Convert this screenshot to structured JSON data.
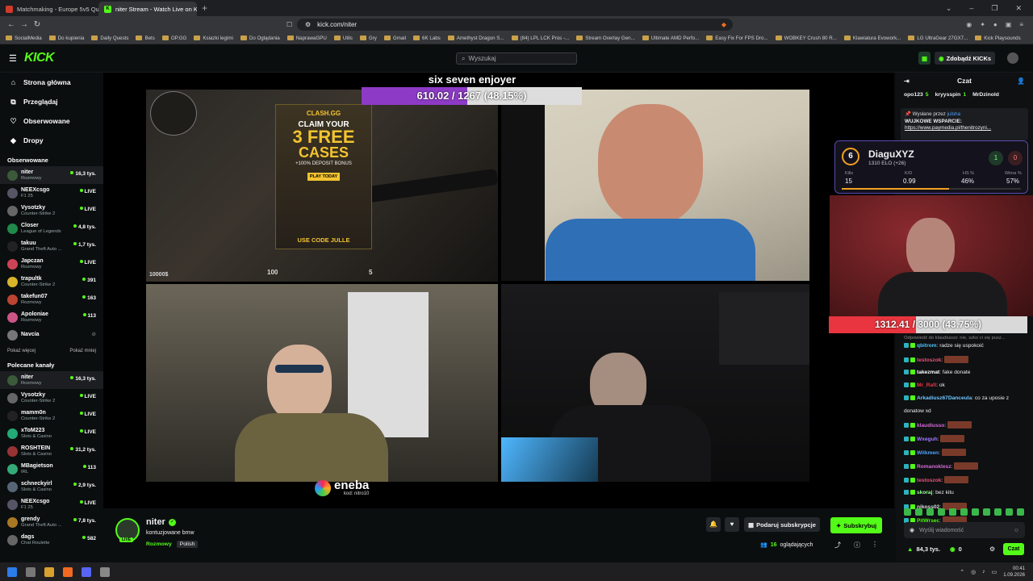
{
  "browser": {
    "tabs": [
      {
        "title": "Matchmaking - Europe 5v5 Queue -",
        "color": "#d23a2a",
        "active": false
      },
      {
        "title": "niter Stream - Watch Live on Kick",
        "color": "#53fc18",
        "active": true
      }
    ],
    "new_tab": "+",
    "url": "kick.com/niter",
    "bookmarks": [
      "SocialMedia",
      "Do kupienia",
      "Daily Quests",
      "Bets",
      "OP.GG",
      "Ksiazki legimi",
      "Do Oglądania",
      "NaprawaGPU",
      "Utils",
      "Gry",
      "Gmail",
      "6K Labs",
      "Amethyst Dragon S...",
      "(84) LPL LCK Pros -...",
      "Stream Overlay Gen...",
      "Ultimate AMD Perfo...",
      "Easy Fix For FPS Dro...",
      "WOBKEY Crush 80 R...",
      "Klawiatura Evowork...",
      "LG UltraGear 27GX7...",
      "Kick Playsounds"
    ]
  },
  "header": {
    "logo": "KICK",
    "search_placeholder": "Wyszukaj",
    "buy_kicks": "Zdobądź KICKs"
  },
  "sidebar": {
    "nav": [
      {
        "label": "Strona główna",
        "icon": "home-icon"
      },
      {
        "label": "Przeglądaj",
        "icon": "browse-icon"
      },
      {
        "label": "Obserwowane",
        "icon": "heart-icon"
      },
      {
        "label": "Dropy",
        "icon": "drops-icon"
      }
    ],
    "followed_title": "Obserwowane",
    "followed": [
      {
        "name": "niter",
        "cat": "Rozmowy",
        "viewers": "16,3 tys.",
        "color": "#3a5a3a"
      },
      {
        "name": "NEEXcsgo",
        "cat": "F1 25",
        "viewers": "LIVE",
        "color": "#556"
      },
      {
        "name": "Vysotzky",
        "cat": "Counter-Strike 2",
        "viewers": "LIVE",
        "color": "#666"
      },
      {
        "name": "Closer",
        "cat": "League of Legends",
        "viewers": "4,8 tys.",
        "color": "#1f8a4a"
      },
      {
        "name": "takuu",
        "cat": "Grand Theft Auto ...",
        "viewers": "1,7 tys.",
        "color": "#222"
      },
      {
        "name": "Japczan",
        "cat": "Rozmowy",
        "viewers": "LIVE",
        "color": "#c45"
      },
      {
        "name": "trapultk",
        "cat": "Counter-Strike 2",
        "viewers": "391",
        "color": "#d8b42a"
      },
      {
        "name": "takefun07",
        "cat": "Rozmowy",
        "viewers": "163",
        "color": "#b43"
      },
      {
        "name": "Apoloniae",
        "cat": "Rozmowy",
        "viewers": "113",
        "color": "#c58"
      },
      {
        "name": "Navcia",
        "cat": "",
        "viewers": "",
        "color": "#777"
      }
    ],
    "show_more": "Pokaż więcej",
    "show_less": "Pokaż mniej",
    "recommended_title": "Polecane kanały",
    "recommended": [
      {
        "name": "niter",
        "cat": "Rozmowy",
        "viewers": "16,3 tys.",
        "color": "#3a5a3a"
      },
      {
        "name": "Vysotzky",
        "cat": "Counter-Strike 2",
        "viewers": "LIVE",
        "color": "#666"
      },
      {
        "name": "mamm0n",
        "cat": "Counter-Strike 2",
        "viewers": "LIVE",
        "color": "#222"
      },
      {
        "name": "xToM223",
        "cat": "Slots & Casino",
        "viewers": "LIVE",
        "color": "#2a7"
      },
      {
        "name": "ROSHTEIN",
        "cat": "Slots & Casino",
        "viewers": "31,2 tys.",
        "color": "#933"
      },
      {
        "name": "MBagietson",
        "cat": "IRL",
        "viewers": "113",
        "color": "#3a7"
      },
      {
        "name": "schneckyirl",
        "cat": "Slots & Casino",
        "viewers": "2,9 tys.",
        "color": "#567"
      },
      {
        "name": "NEEXcsgo",
        "cat": "F1 25",
        "viewers": "LIVE",
        "color": "#556"
      },
      {
        "name": "grendy",
        "cat": "Grand Theft Auto ...",
        "viewers": "7,8 tys.",
        "color": "#a72"
      },
      {
        "name": "dags",
        "cat": "Chat Roulette",
        "viewers": "582",
        "color": "#666"
      }
    ]
  },
  "stream": {
    "overlay_title": "six seven enjoyer",
    "goal_text": "610.02 / 1267 (48.15%)",
    "goal_fraction": 0.4815,
    "ad_brand": "CLASH.GG",
    "ad_line1": "CLAIM YOUR",
    "ad_line2": "3 FREE",
    "ad_line3": "CASES",
    "ad_line4": "+100% DEPOSIT BONUS",
    "ad_code": "USE CODE JULLE",
    "ad_play": "PLAY TODAY",
    "sponsor": "eneba",
    "sponsor_code": "kod: nitro10",
    "hud_hp": "100",
    "hud_money": "10000$",
    "hud_ammo": "5"
  },
  "elo_card": {
    "level": "6",
    "name": "DiaguXYZ",
    "elo": "1310 ELO (+26)",
    "wins": "1",
    "losses": "0",
    "kills_label": "Kills",
    "kills": "15",
    "kd_label": "K/D",
    "kd": "0.99",
    "hs_label": "HS %",
    "hs": "46%",
    "winrate_label": "Winra %",
    "winrate": "57%"
  },
  "overlay_goal": {
    "text": "1312.41 / 3000 (43.75%)",
    "fraction": 0.4375
  },
  "channel": {
    "name": "niter",
    "title": "kontuzjowane bmw",
    "category": "Rozmowy",
    "language": "Polish",
    "gift_sub": "Podaruj subskrypcje",
    "subscribe": "Subskrybuj",
    "viewers": "16",
    "viewers_label": "oglądających"
  },
  "chat": {
    "title": "Czat",
    "top_gifters": [
      {
        "name": "opo123",
        "count": "5"
      },
      {
        "name": "kryysspin",
        "count": "1"
      },
      {
        "name": "MrDzinold",
        "count": ""
      }
    ],
    "pinned_by": "Wysłane przez",
    "pinned_user": "julsha",
    "pinned_title": "WUJKOWE WSPARCIE:",
    "pinned_link": "https://www.paymedia.pl/thenitrozyni...",
    "reply_hint": "Odpowiedź do klaudiusso: nie, szko ci się pusz...",
    "messages": [
      {
        "user": "qbitrom",
        "text": "radze się uspokoić",
        "color": "#4fc3f7",
        "emote": false
      },
      {
        "user": "testoszok",
        "text": "",
        "color": "#e8537a",
        "emote": true
      },
      {
        "user": "takezmat",
        "text": "fake donate",
        "color": "#fff",
        "emote": false
      },
      {
        "user": "Mr_Rafi",
        "text": "ok",
        "color": "#e8353f",
        "emote": false
      },
      {
        "user": "Arkadiusz67Danceula",
        "text": "co za uposie z",
        "color": "#6ec6ff",
        "emote": false
      },
      {
        "user": "",
        "text": "donatow xd",
        "color": "#fff",
        "emote": false
      },
      {
        "user": "klaudiusso",
        "text": "",
        "color": "#d46ad4",
        "emote": true
      },
      {
        "user": "Wxeguh",
        "text": "",
        "color": "#a07aff",
        "emote": true
      },
      {
        "user": "Wilkmen",
        "text": "",
        "color": "#4fa3ff",
        "emote": true
      },
      {
        "user": "Romanoklesz",
        "text": "",
        "color": "#d46ad4",
        "emote": true
      },
      {
        "user": "testoszok",
        "text": "",
        "color": "#e8537a",
        "emote": true
      },
      {
        "user": "skoraj",
        "text": "bez kitu",
        "color": "#9aff9a",
        "emote": false
      },
      {
        "user": "nikoss02",
        "text": "",
        "color": "#ddd",
        "emote": true
      },
      {
        "user": "PitWrsec",
        "text": "",
        "color": "#53fc18",
        "emote": true
      }
    ],
    "input_placeholder": "Wyślij wiadomość",
    "kicks_balance": "84,3 tys.",
    "points": "0",
    "send": "Czat"
  },
  "taskbar": {
    "time": "00:41",
    "date": "1.09.2026"
  }
}
